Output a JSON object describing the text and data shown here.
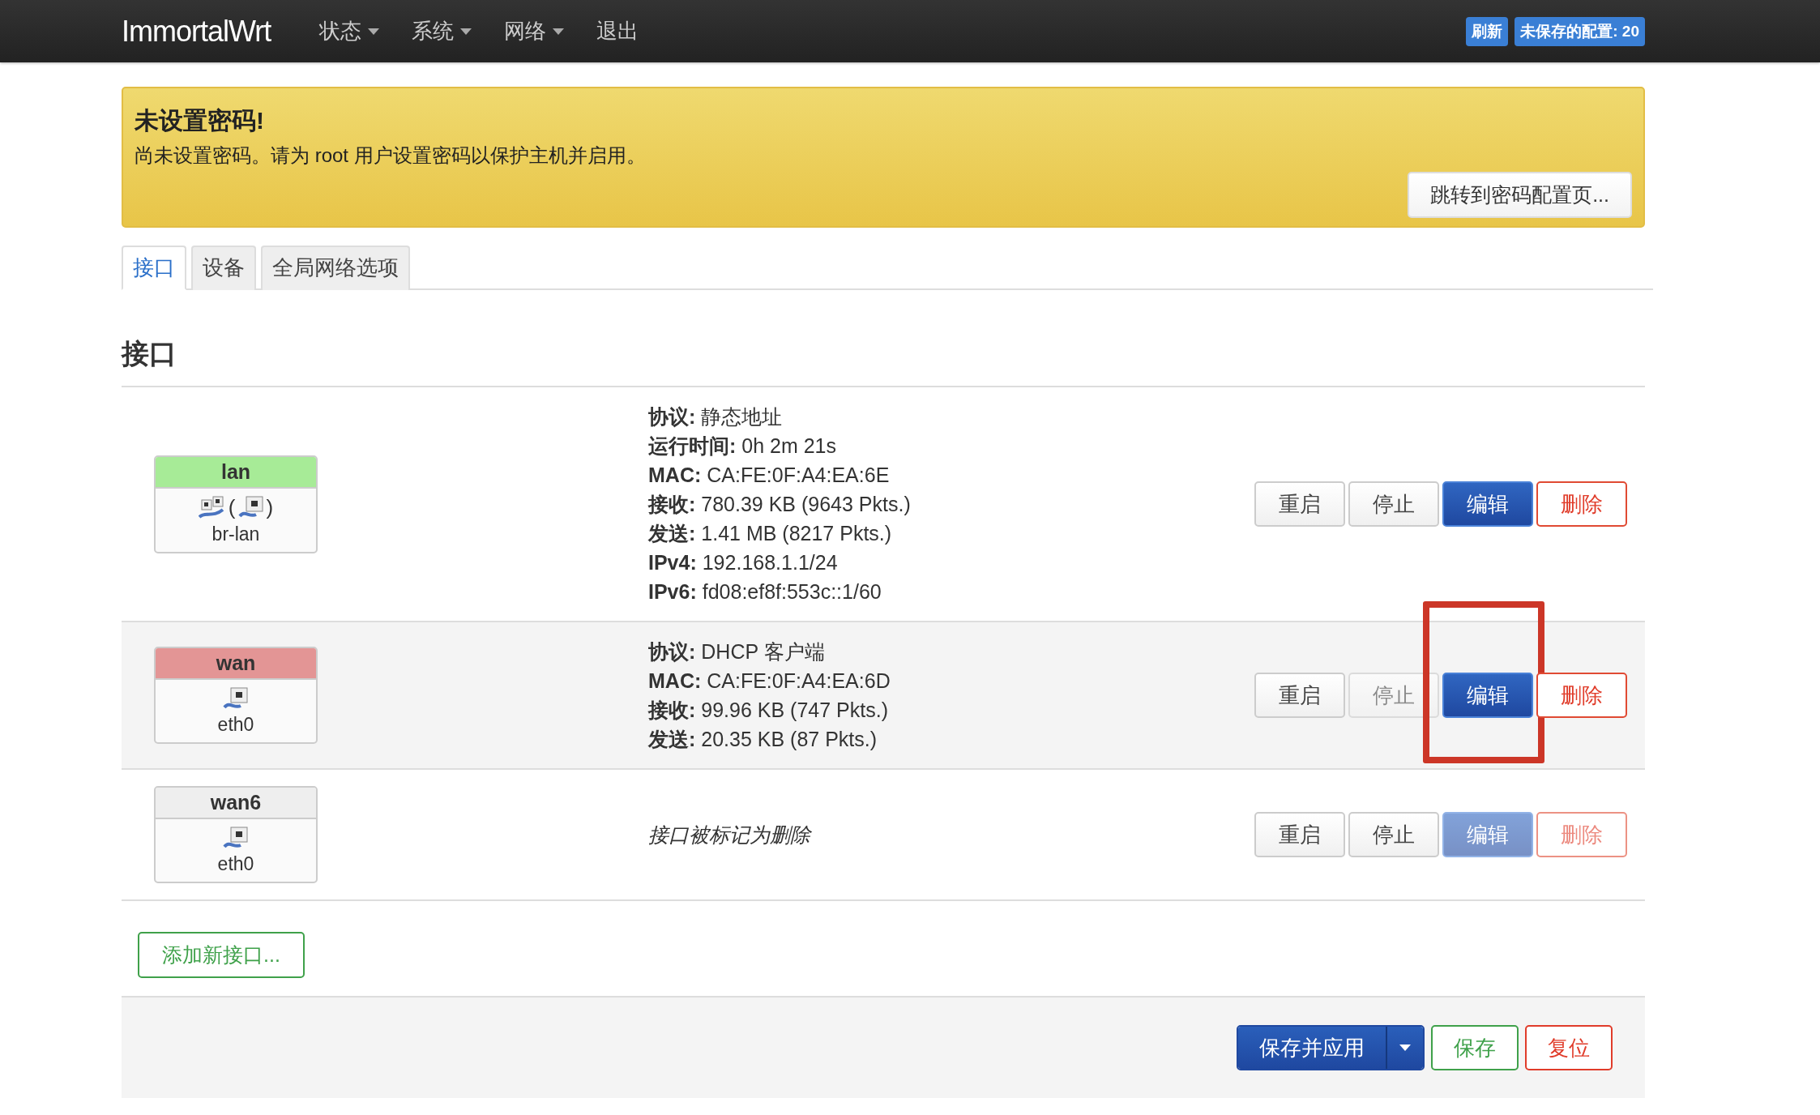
{
  "navbar": {
    "brand": "ImmortalWrt",
    "menu": [
      {
        "label": "状态",
        "dropdown": true
      },
      {
        "label": "系统",
        "dropdown": true
      },
      {
        "label": "网络",
        "dropdown": true
      },
      {
        "label": "退出",
        "dropdown": false
      }
    ],
    "badges": [
      "刷新",
      "未保存的配置: 20"
    ]
  },
  "alert": {
    "title": "未设置密码!",
    "text": "尚未设置密码。请为 root 用户设置密码以保护主机并启用。",
    "button": "跳转到密码配置页..."
  },
  "tabs": [
    {
      "label": "接口",
      "selected": true
    },
    {
      "label": "设备",
      "selected": false
    },
    {
      "label": "全局网络选项",
      "selected": false
    }
  ],
  "section_title": "接口",
  "interfaces": [
    {
      "name": "lan",
      "color": "#a7eb97",
      "device": {
        "name": "br-lan",
        "kind": "bridge",
        "open": "(",
        "close": ")"
      },
      "details": [
        {
          "label": "协议:",
          "value": "静态地址"
        },
        {
          "label": "运行时间:",
          "value": "0h 2m 21s"
        },
        {
          "label": "MAC:",
          "value": "CA:FE:0F:A4:EA:6E"
        },
        {
          "label": "接收:",
          "value": "780.39 KB (9643 Pkts.)"
        },
        {
          "label": "发送:",
          "value": "1.41 MB (8217 Pkts.)"
        },
        {
          "label": "IPv4:",
          "value": "192.168.1.1/24"
        },
        {
          "label": "IPv6:",
          "value": "fd08:ef8f:553c::1/60"
        }
      ],
      "buttons": [
        {
          "label": "重启",
          "kind": "neutral",
          "disabled": false,
          "annotated": false
        },
        {
          "label": "停止",
          "kind": "neutral",
          "disabled": false,
          "annotated": false
        },
        {
          "label": "编辑",
          "kind": "primary",
          "disabled": false,
          "annotated": false
        },
        {
          "label": "删除",
          "kind": "danger",
          "disabled": false,
          "annotated": false
        }
      ]
    },
    {
      "name": "wan",
      "color": "#e39595",
      "device": {
        "name": "eth0",
        "kind": "port"
      },
      "details": [
        {
          "label": "协议:",
          "value": "DHCP 客户端"
        },
        {
          "label": "MAC:",
          "value": "CA:FE:0F:A4:EA:6D"
        },
        {
          "label": "接收:",
          "value": "99.96 KB (747 Pkts.)"
        },
        {
          "label": "发送:",
          "value": "20.35 KB (87 Pkts.)"
        }
      ],
      "buttons": [
        {
          "label": "重启",
          "kind": "neutral",
          "disabled": false,
          "annotated": false
        },
        {
          "label": "停止",
          "kind": "neutral",
          "disabled": true,
          "annotated": false
        },
        {
          "label": "编辑",
          "kind": "primary",
          "disabled": false,
          "annotated": true
        },
        {
          "label": "删除",
          "kind": "danger",
          "disabled": false,
          "annotated": false
        }
      ]
    },
    {
      "name": "wan6",
      "color": "#eeeeee",
      "device": {
        "name": "eth0",
        "kind": "port"
      },
      "note": "接口被标记为删除",
      "buttons": [
        {
          "label": "重启",
          "kind": "neutral",
          "disabled": false,
          "annotated": false
        },
        {
          "label": "停止",
          "kind": "neutral",
          "disabled": false,
          "annotated": false
        },
        {
          "label": "编辑",
          "kind": "primary",
          "disabled": true,
          "annotated": false
        },
        {
          "label": "删除",
          "kind": "danger",
          "disabled": true,
          "annotated": false
        }
      ]
    }
  ],
  "add_button": "添加新接口...",
  "footer": {
    "save_apply": "保存并应用",
    "save": "保存",
    "reset": "复位"
  }
}
